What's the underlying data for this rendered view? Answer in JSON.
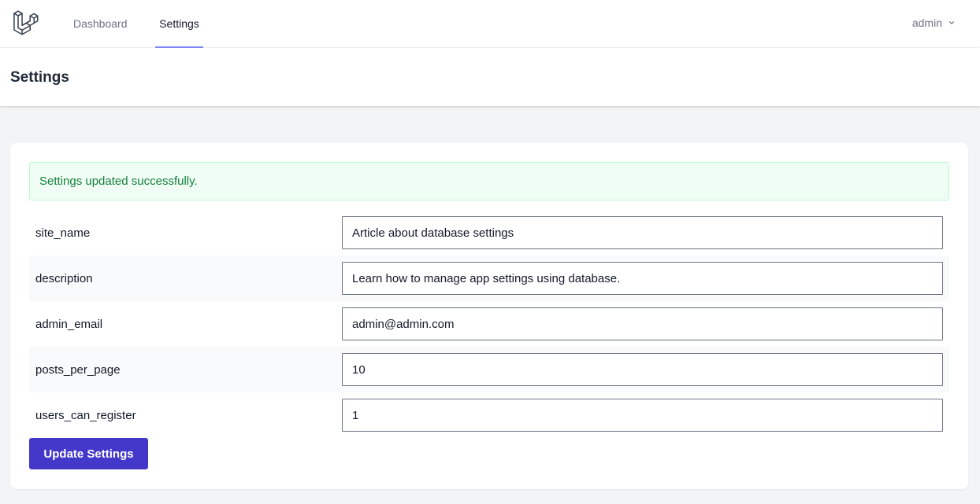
{
  "nav": {
    "logo_icon": "laravel-logo-icon",
    "links": [
      {
        "label": "Dashboard",
        "active": false
      },
      {
        "label": "Settings",
        "active": true
      }
    ],
    "user": {
      "name": "admin",
      "icon": "chevron-down-icon"
    }
  },
  "header": {
    "title": "Settings"
  },
  "alert": {
    "message": "Settings updated successfully.",
    "color": "#15803d",
    "background": "#f0fdf4"
  },
  "settings": [
    {
      "key": "site_name",
      "value": "Article about database settings"
    },
    {
      "key": "description",
      "value": "Learn how to manage app settings using database."
    },
    {
      "key": "admin_email",
      "value": "admin@admin.com"
    },
    {
      "key": "posts_per_page",
      "value": "10"
    },
    {
      "key": "users_can_register",
      "value": "1"
    }
  ],
  "form": {
    "submit_label": "Update Settings"
  },
  "colors": {
    "accent": "#4338ca",
    "active_tab_underline": "#818cf8"
  }
}
